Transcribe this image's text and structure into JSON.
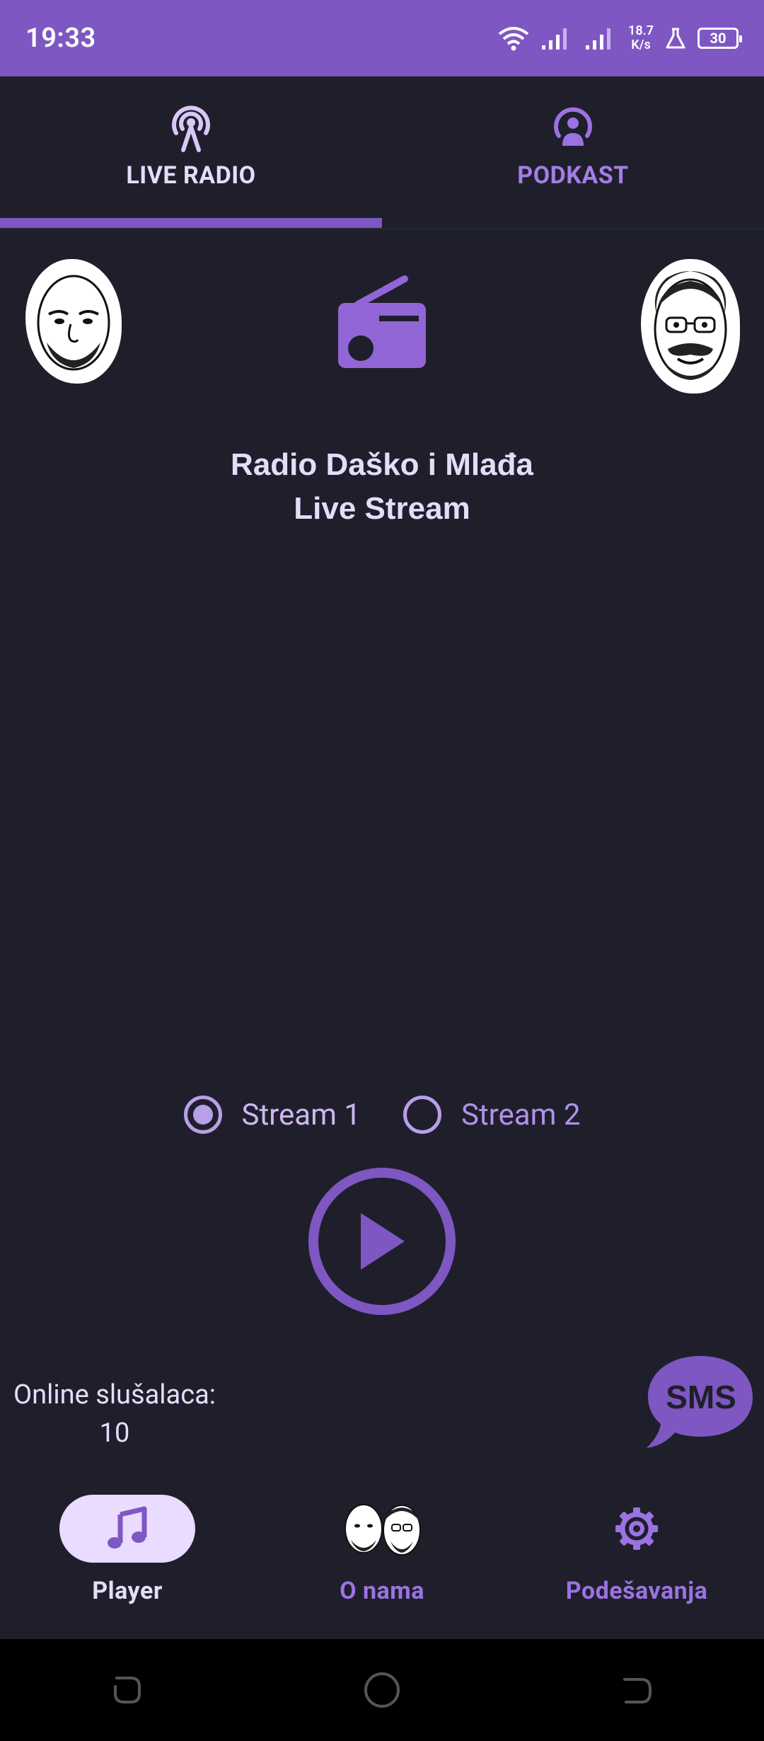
{
  "status_bar": {
    "time": "19:33",
    "speed_value": "18.7",
    "speed_unit": "K/s",
    "battery": "30",
    "icons": [
      "wifi-icon",
      "signal-icon",
      "signal-icon",
      "lab-flask-icon",
      "battery-icon"
    ]
  },
  "tabs": [
    {
      "label": "LIVE RADIO",
      "icon": "broadcast-tower-icon",
      "active": true
    },
    {
      "label": "PODKAST",
      "icon": "podcast-icon",
      "active": false
    }
  ],
  "station": {
    "title_line1": "Radio Daško i Mlađa",
    "title_line2": "Live Stream"
  },
  "streams": {
    "options": [
      "Stream 1",
      "Stream 2"
    ],
    "selected": "Stream 1"
  },
  "listeners": {
    "label": "Online slušalaca:",
    "count": "10"
  },
  "sms": {
    "label": "SMS"
  },
  "bottom_nav": [
    {
      "label": "Player",
      "icon": "music-note-icon",
      "active": true
    },
    {
      "label": "O nama",
      "icon": "hosts-faces-icon",
      "active": false
    },
    {
      "label": "Podešavanja",
      "icon": "gear-icon",
      "active": false
    }
  ],
  "colors": {
    "accent": "#7e57c2",
    "background": "#1f1f2b",
    "active_text": "#e6dcfa",
    "inactive_text": "#a47de6"
  }
}
